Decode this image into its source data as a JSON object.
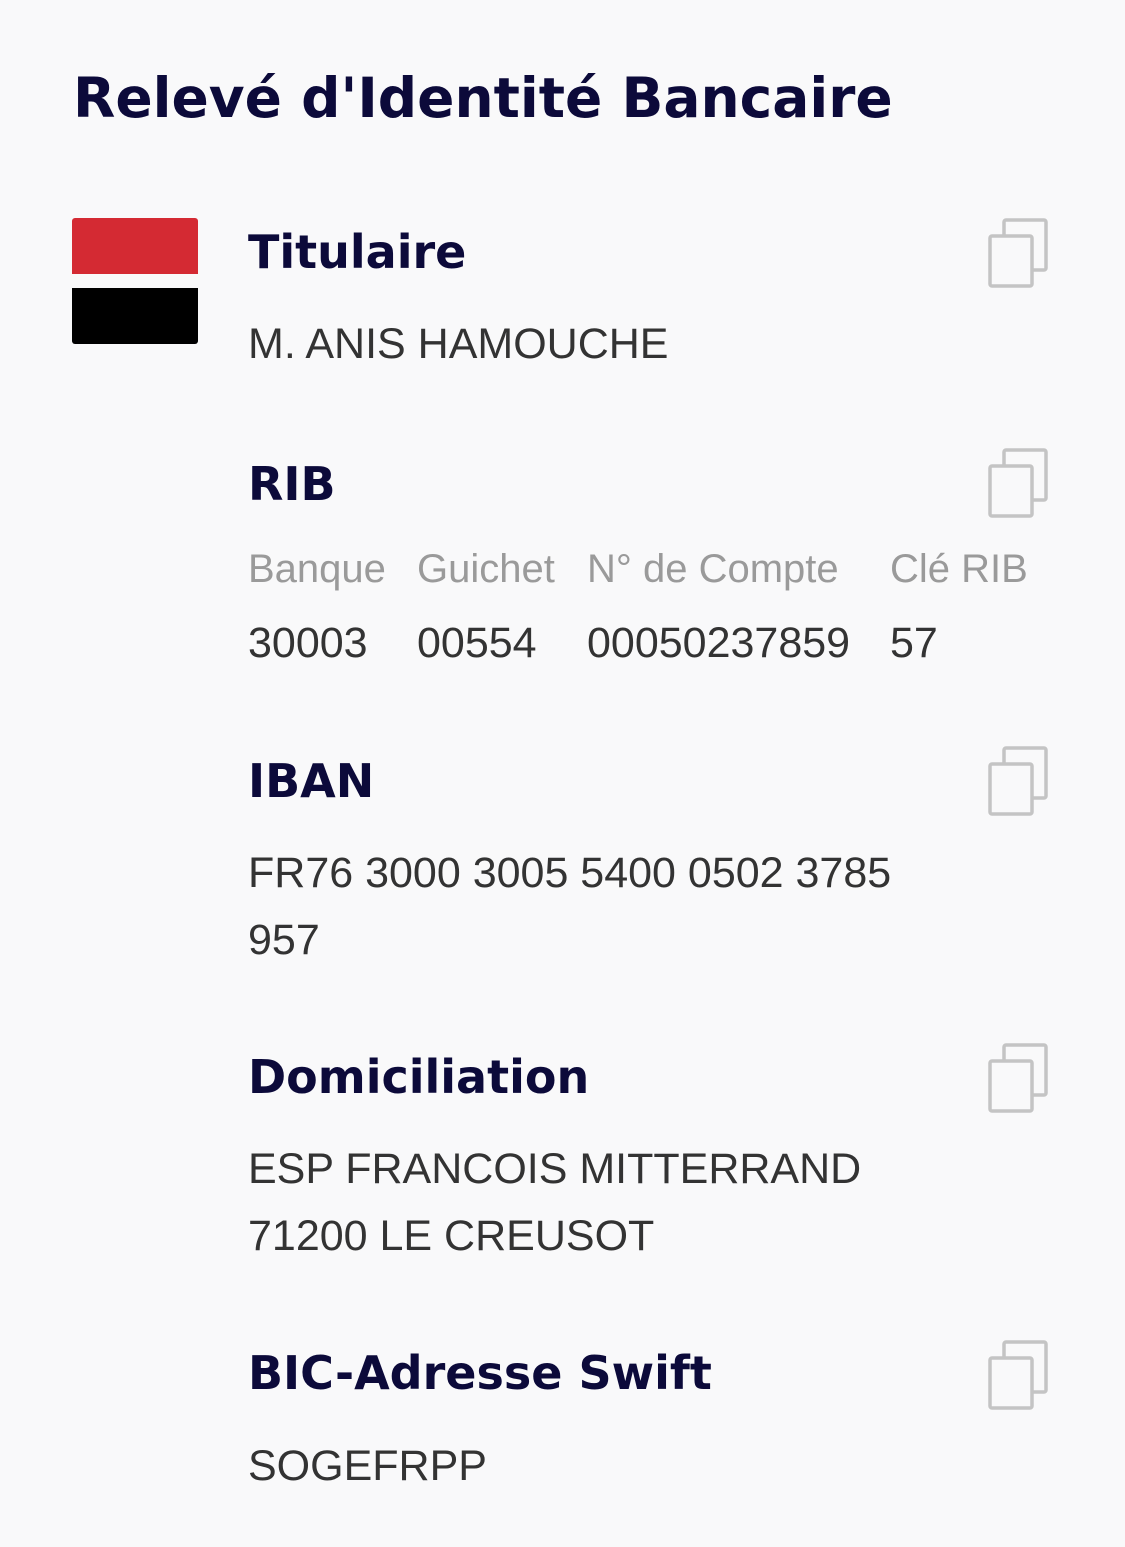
{
  "page": {
    "title": "Relevé d'Identité Bancaire"
  },
  "logo": {
    "icon": "bank-logo-icon",
    "colors": {
      "top": "#d42a33",
      "bottom": "#000000"
    }
  },
  "titulaire": {
    "label": "Titulaire",
    "value": "M. ANIS HAMOUCHE"
  },
  "rib": {
    "label": "RIB",
    "columns": [
      {
        "label": "Banque",
        "value": "30003"
      },
      {
        "label": "Guichet",
        "value": "00554"
      },
      {
        "label": "N° de Compte",
        "value": "00050237859"
      },
      {
        "label": "Clé RIB",
        "value": "57"
      }
    ]
  },
  "iban": {
    "label": "IBAN",
    "value_line1": "FR76 3000 3005 5400 0502 3785",
    "value_line2": "957"
  },
  "domiciliation": {
    "label": "Domiciliation",
    "value_line1": "ESP FRANCOIS MITTERRAND",
    "value_line2": "71200 LE CREUSOT"
  },
  "bic": {
    "label": "BIC-Adresse Swift",
    "value": "SOGEFRPP"
  },
  "icons": {
    "copy": "copy-icon"
  },
  "colors": {
    "title": "#0c0a3a",
    "value": "#333333",
    "secondary": "#9a9a9a",
    "icon": "#c4c4c4",
    "background": "#f9f9fa"
  }
}
